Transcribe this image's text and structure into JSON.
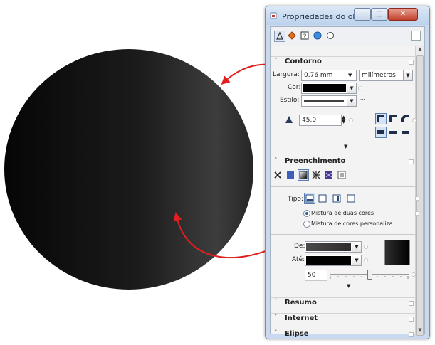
{
  "window": {
    "title": "Propriedades do objeto"
  },
  "contorno": {
    "header": "Contorno",
    "largura_label": "Largura:",
    "largura_value": "0.76 mm",
    "unidade_value": "milímetros",
    "cor_label": "Cor:",
    "cor_color": "#000000",
    "estilo_label": "Estilo:",
    "more": "...",
    "miter_value": "45.0"
  },
  "preenchimento": {
    "header": "Preenchimento",
    "tipo_label": "Tipo:",
    "radio1": "Mistura de duas cores",
    "radio2": "Mistura de cores personaliza",
    "de_label": "De:",
    "ate_label": "Até:",
    "de_color": "#3a3a3a",
    "ate_color": "#000000",
    "mid_value": "50",
    "mid_level_percent": 50
  },
  "sections": {
    "resumo": "Resumo",
    "internet": "Internet",
    "elipse": "Elipse"
  },
  "colors": {
    "accent_red": "#e02020",
    "titlebar": "#c9daf0"
  }
}
